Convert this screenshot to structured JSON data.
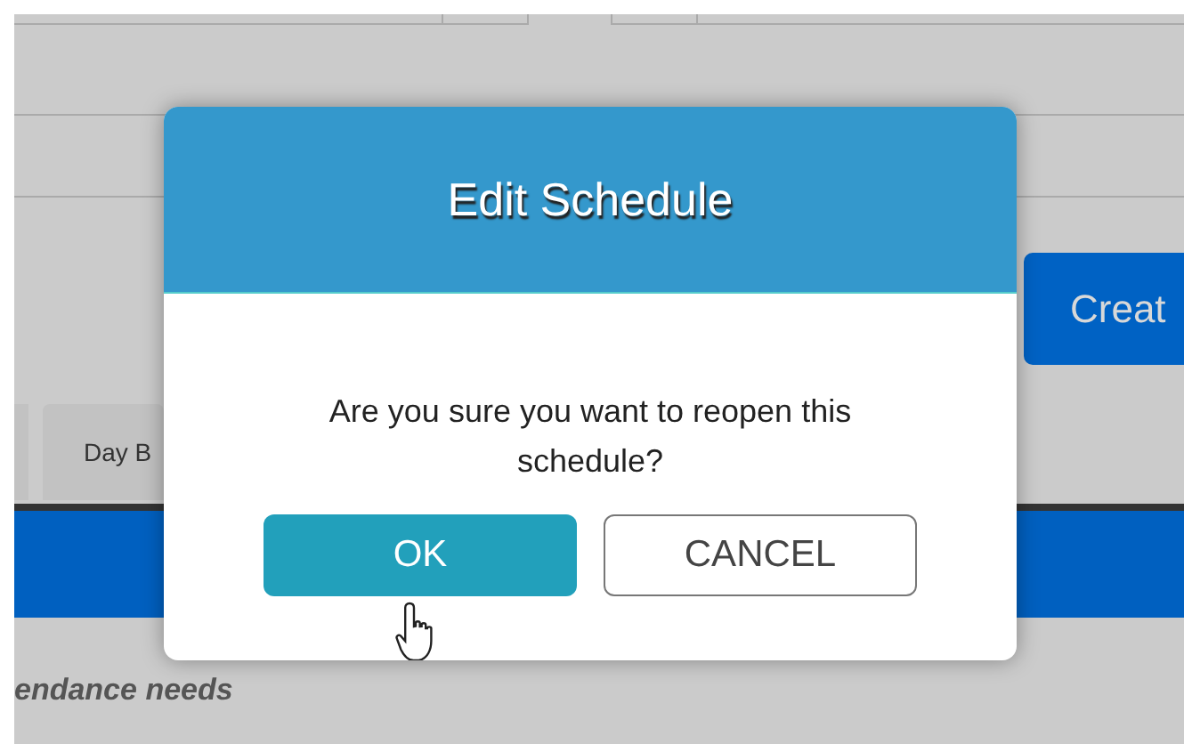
{
  "background": {
    "create_button": "Creat",
    "tabs": [
      {
        "label": "Day B"
      }
    ],
    "note": "endance needs"
  },
  "dialog": {
    "title": "Edit Schedule",
    "message": "Are you sure you want to reopen this schedule?",
    "buttons": [
      {
        "label": "OK",
        "kind": "primary"
      },
      {
        "label": "CANCEL",
        "kind": "secondary"
      }
    ]
  }
}
